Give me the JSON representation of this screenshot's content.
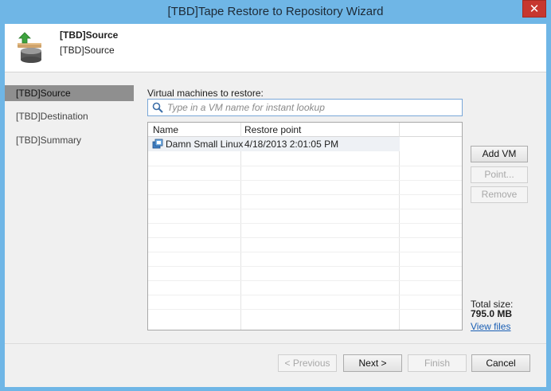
{
  "window": {
    "title": "[TBD]Tape Restore to Repository Wizard",
    "close_glyph": "✕"
  },
  "header": {
    "title": "[TBD]Source",
    "subtitle": "[TBD]Source",
    "icon": "database-restore-icon"
  },
  "nav": {
    "items": [
      {
        "label": "[TBD]Source",
        "active": true
      },
      {
        "label": "[TBD]Destination",
        "active": false
      },
      {
        "label": "[TBD]Summary",
        "active": false
      }
    ]
  },
  "content": {
    "vm_label": "Virtual machines to restore:",
    "search": {
      "placeholder": "Type in a VM name for instant lookup",
      "value": "",
      "icon": "search-icon"
    },
    "table": {
      "columns": [
        "Name",
        "Restore point"
      ],
      "rows": [
        {
          "name": "Damn Small Linux",
          "restore_point": "4/18/2013 2:01:05 PM",
          "icon": "vm-icon",
          "selected": true
        }
      ]
    },
    "buttons": {
      "add_vm": "Add VM",
      "point": "Point...",
      "remove": "Remove"
    },
    "total": {
      "label": "Total size:",
      "value": "795.0 MB",
      "view_files": "View files"
    }
  },
  "footer": {
    "previous": "< Previous",
    "next": "Next >",
    "finish": "Finish",
    "cancel": "Cancel"
  },
  "colors": {
    "titlebar": "#6fb6e6",
    "close": "#c7372f",
    "nav_active": "#8f8f8f",
    "link": "#1a5fb4"
  }
}
